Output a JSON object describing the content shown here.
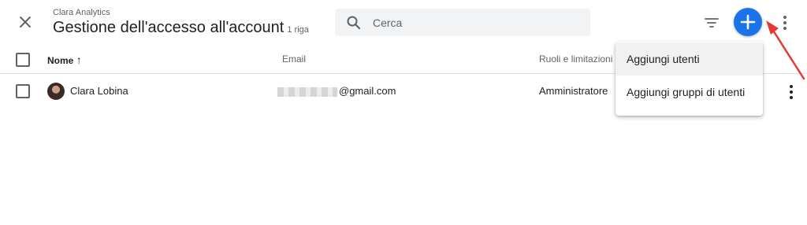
{
  "header": {
    "subtitle": "Clara Analytics",
    "title": "Gestione dell'accesso all'account",
    "row_count": "1 riga"
  },
  "search": {
    "placeholder": "Cerca",
    "value": ""
  },
  "icons": {
    "close": "close-icon",
    "search": "search-icon",
    "filter": "filter-icon",
    "add": "plus-icon",
    "more": "more-vert-icon"
  },
  "table": {
    "columns": [
      "Nome",
      "Email",
      "Ruoli e limitazioni"
    ],
    "sort_indicator": "↑",
    "rows": [
      {
        "name": "Clara Lobina",
        "email": "@gmail.com",
        "role": "Amministratore"
      }
    ]
  },
  "menu": {
    "items": [
      "Aggiungi utenti",
      "Aggiungi gruppi di utenti"
    ]
  },
  "colors": {
    "accent": "#1a73e8",
    "annotation_arrow": "#e53935"
  }
}
